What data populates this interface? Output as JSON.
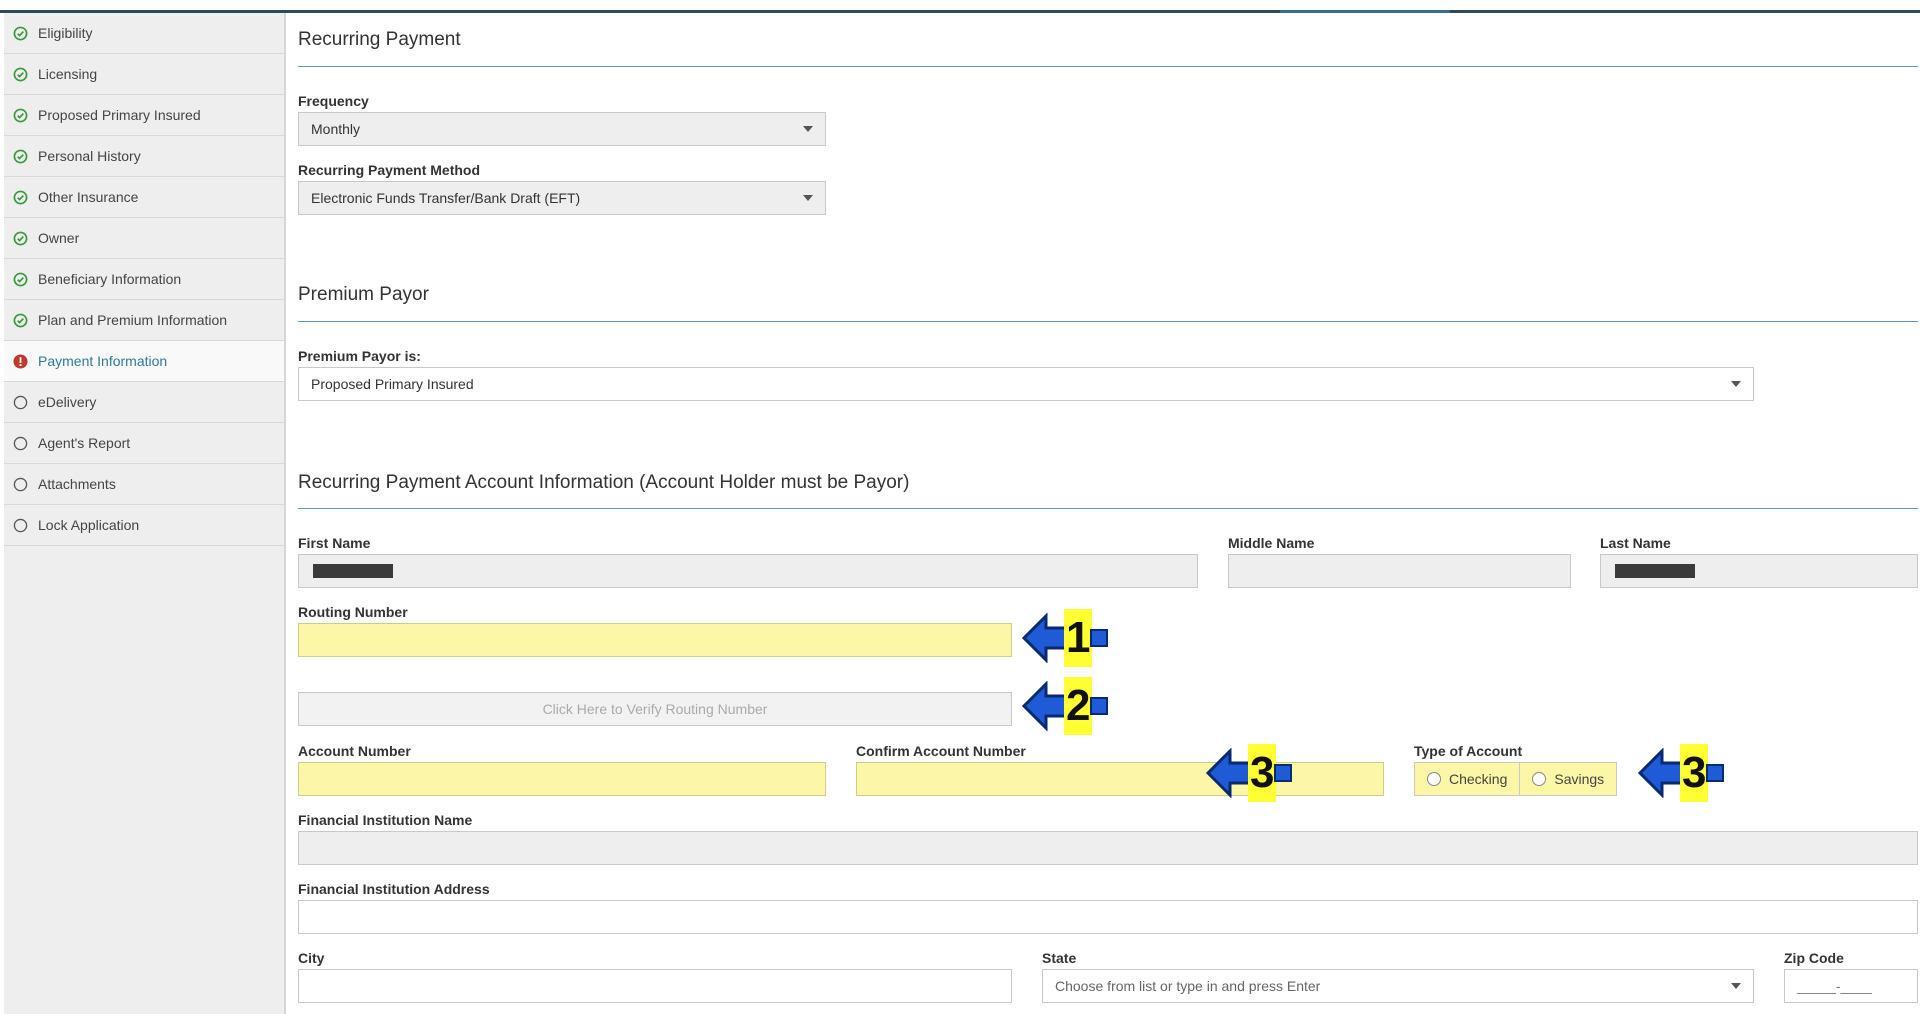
{
  "sidebar": {
    "items": [
      {
        "label": "Eligibility",
        "status": "complete"
      },
      {
        "label": "Licensing",
        "status": "complete"
      },
      {
        "label": "Proposed Primary Insured",
        "status": "complete"
      },
      {
        "label": "Personal History",
        "status": "complete"
      },
      {
        "label": "Other Insurance",
        "status": "complete"
      },
      {
        "label": "Owner",
        "status": "complete"
      },
      {
        "label": "Beneficiary Information",
        "status": "complete"
      },
      {
        "label": "Plan and Premium Information",
        "status": "complete"
      },
      {
        "label": "Payment Information",
        "status": "error"
      },
      {
        "label": "eDelivery",
        "status": "incomplete"
      },
      {
        "label": "Agent's Report",
        "status": "incomplete"
      },
      {
        "label": "Attachments",
        "status": "incomplete"
      },
      {
        "label": "Lock Application",
        "status": "incomplete"
      }
    ]
  },
  "recurring": {
    "title": "Recurring Payment",
    "frequency_label": "Frequency",
    "frequency_value": "Monthly",
    "method_label": "Recurring Payment Method",
    "method_value": "Electronic Funds Transfer/Bank Draft (EFT)"
  },
  "payor": {
    "title": "Premium Payor",
    "label": "Premium Payor is:",
    "value": "Proposed Primary Insured"
  },
  "account": {
    "title": "Recurring Payment Account Information (Account Holder must be Payor)",
    "first_name_label": "First Name",
    "middle_name_label": "Middle Name",
    "last_name_label": "Last Name",
    "routing_label": "Routing Number",
    "verify_button": "Click Here to Verify Routing Number",
    "account_number_label": "Account Number",
    "confirm_account_label": "Confirm Account Number",
    "type_label": "Type of Account",
    "type_options": [
      "Checking",
      "Savings"
    ],
    "fin_name_label": "Financial Institution Name",
    "fin_address_label": "Financial Institution Address",
    "city_label": "City",
    "state_label": "State",
    "state_placeholder": "Choose from list or type in and press Enter",
    "zip_label": "Zip Code",
    "zip_placeholder": "_____-____"
  },
  "annotations": [
    "1",
    "2",
    "3",
    "3"
  ],
  "colors": {
    "accent": "#2f7a9b",
    "complete": "#3a9a3a",
    "error": "#c0392b",
    "required_field": "#fbf7a6",
    "annotation_arrow": "#1f5bd6",
    "annotation_highlight": "#ffff33"
  }
}
